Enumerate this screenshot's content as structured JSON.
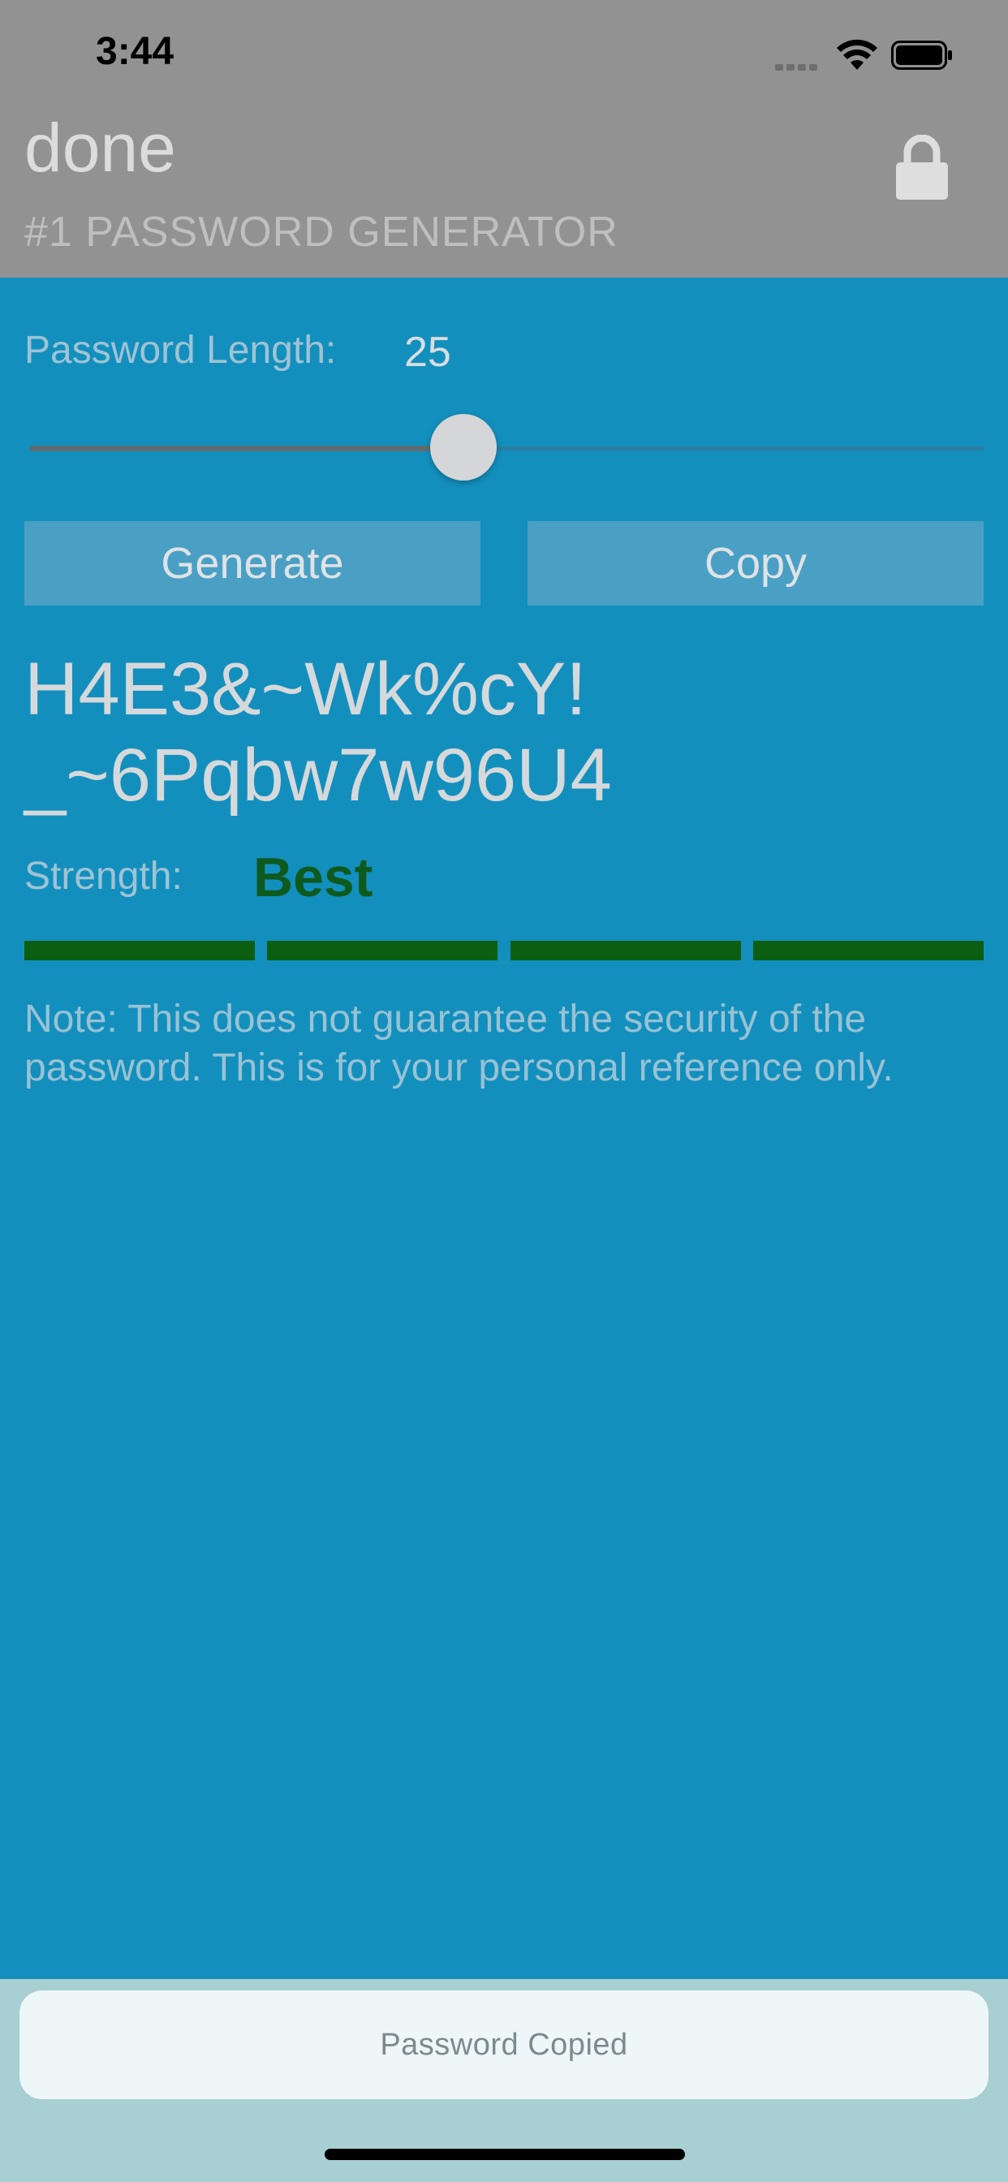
{
  "status_bar": {
    "time": "3:44"
  },
  "header": {
    "title": "done",
    "subtitle": "#1 PASSWORD GENERATOR",
    "icon": "lock-icon"
  },
  "length": {
    "label": "Password Length:",
    "value": "25",
    "slider_fraction": 0.45
  },
  "buttons": {
    "generate_label": "Generate",
    "copy_label": "Copy"
  },
  "password": {
    "line1": "H4E3&~Wk%cY!",
    "line2": "_~6Pqbw7w96U4"
  },
  "strength": {
    "label": "Strength:",
    "value": "Best",
    "segments_filled": 4,
    "segments_total": 4,
    "color": "#0b5e12"
  },
  "note": {
    "line1": "Note: This does not guarantee the security of the",
    "line2": "password. This is for your personal reference only."
  },
  "toast": {
    "message": "Password Copied"
  },
  "colors": {
    "background": "#138fbd",
    "header": "#929292",
    "button": "#4a9fc4"
  }
}
